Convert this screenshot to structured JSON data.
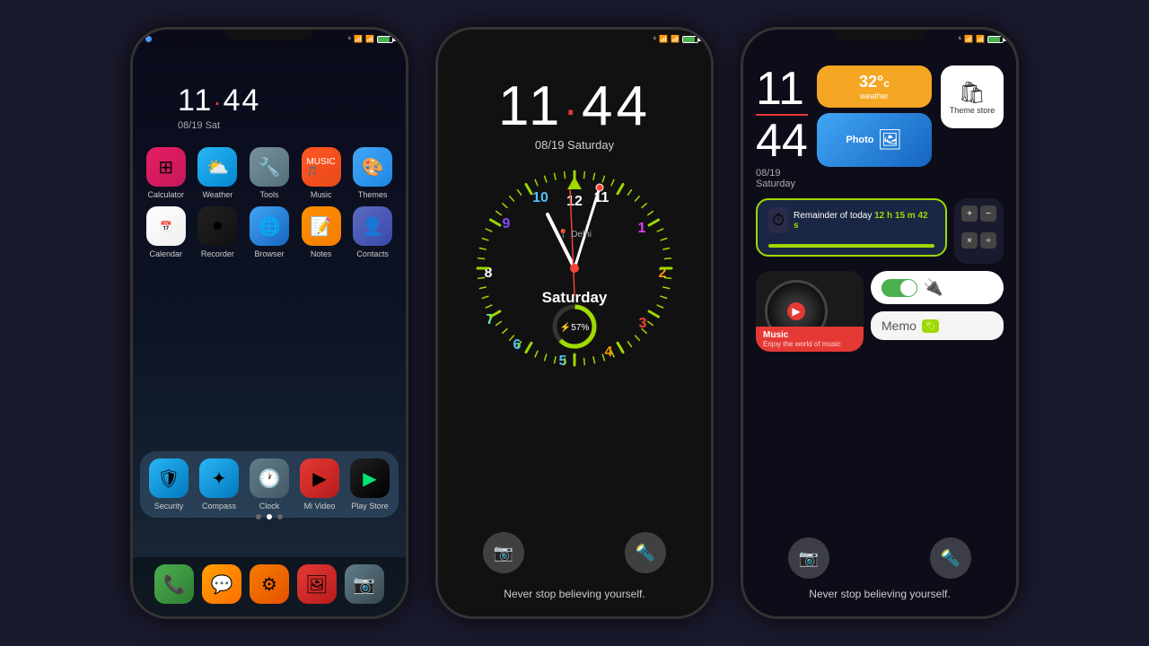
{
  "phone1": {
    "statusBar": {
      "leftDot": true,
      "rightIcons": "🔵📶📶🔋"
    },
    "time": "11",
    "timeSep": ":",
    "timeMin": "44",
    "date": "08/19  Sat",
    "apps": [
      {
        "label": "Calculator",
        "icon": "calc",
        "emoji": "⊞"
      },
      {
        "label": "Weather",
        "icon": "weather",
        "emoji": "⛅"
      },
      {
        "label": "Tools",
        "icon": "tools",
        "emoji": "🔧"
      },
      {
        "label": "Music",
        "icon": "music",
        "emoji": "🎵"
      },
      {
        "label": "Themes",
        "icon": "themes",
        "emoji": "🎨"
      },
      {
        "label": "Calendar",
        "icon": "calendar",
        "emoji": "📅"
      },
      {
        "label": "Recorder",
        "icon": "recorder",
        "emoji": "⏺"
      },
      {
        "label": "Browser",
        "icon": "browser",
        "emoji": "🌐"
      },
      {
        "label": "Notes",
        "icon": "notes",
        "emoji": "📝"
      },
      {
        "label": "Contacts",
        "icon": "contacts",
        "emoji": "👤"
      },
      {
        "label": "Security",
        "icon": "security",
        "emoji": "🛡"
      },
      {
        "label": "Compass",
        "icon": "compass",
        "emoji": "✦"
      },
      {
        "label": "Clock",
        "icon": "clock",
        "emoji": "🕐"
      },
      {
        "label": "Mi Video",
        "icon": "mivideo",
        "emoji": "▶"
      },
      {
        "label": "Play Store",
        "icon": "playstore",
        "emoji": "▶"
      }
    ],
    "dock": [
      {
        "label": "Phone",
        "emoji": "📞"
      },
      {
        "label": "Messages",
        "emoji": "💬"
      },
      {
        "label": "Settings",
        "emoji": "⚙"
      },
      {
        "label": "Gallery",
        "emoji": "🖼"
      },
      {
        "label": "Camera",
        "emoji": "📷"
      }
    ]
  },
  "phone2": {
    "time": "11",
    "timeSep": "·",
    "timeMin": "44",
    "date": "08/19 Saturday",
    "dayLabel": "Saturday",
    "location": "Delhi",
    "battery": "57%",
    "message": "Never stop believing yourself."
  },
  "phone3": {
    "hour": "11",
    "min": "44",
    "date": "08/19",
    "day": "Saturday",
    "weather": {
      "temp": "32°",
      "unit": "c",
      "label": "weather"
    },
    "themeStore": "Theme store",
    "photoLabel": "Photo",
    "reminder": {
      "label": "Remainder of today",
      "hours": "12",
      "h": "h",
      "min": "15",
      "m": "m",
      "sec": "42",
      "s": "s"
    },
    "musicTitle": "Music",
    "musicSub": "Enjoy the world of music",
    "memoLabel": "Memo",
    "message": "Never stop believing yourself."
  }
}
